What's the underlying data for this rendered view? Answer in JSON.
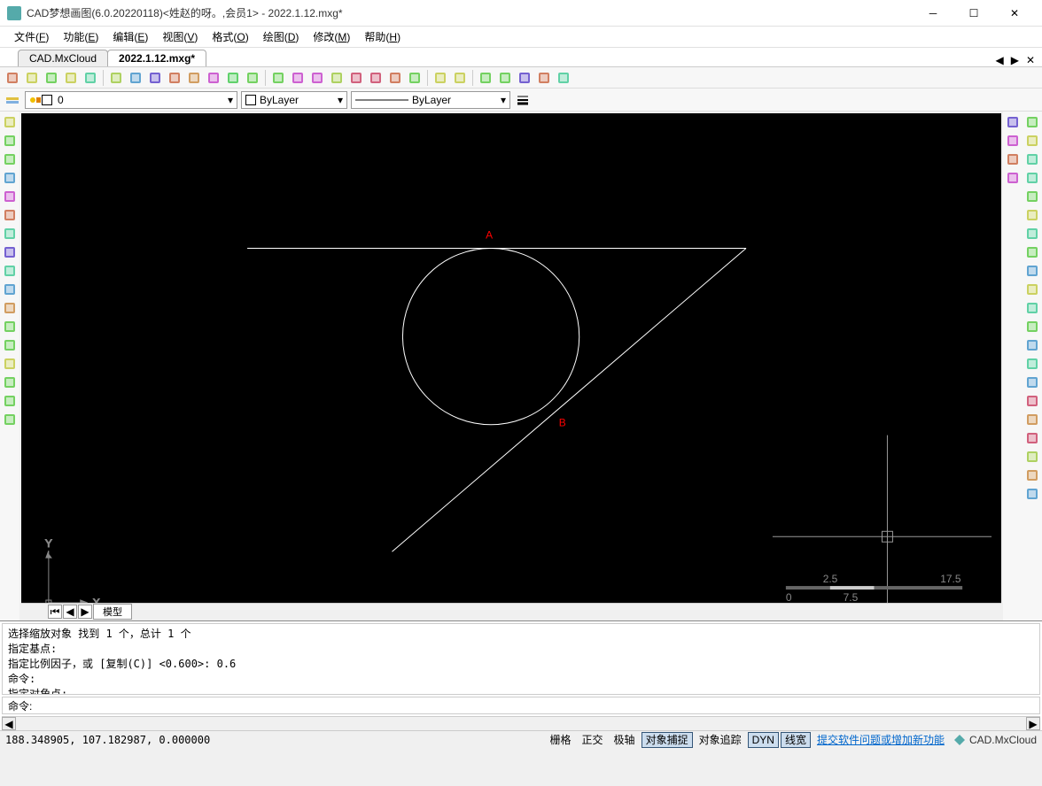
{
  "title": "CAD梦想画图(6.0.20220118)<姓赵的呀。,会员1> - 2022.1.12.mxg*",
  "menu": [
    "文件(F)",
    "功能(E)",
    "编辑(E)",
    "视图(V)",
    "格式(O)",
    "绘图(D)",
    "修改(M)",
    "帮助(H)"
  ],
  "tabs": {
    "items": [
      "CAD.MxCloud",
      "2022.1.12.mxg*"
    ],
    "active": 1
  },
  "layer": {
    "name": "0",
    "color_swatch": "#ffffff"
  },
  "colorSel": "ByLayer",
  "linetypeSel": "ByLayer",
  "canvas": {
    "labelA": "A",
    "labelB": "B",
    "axisX": "X",
    "axisY": "Y",
    "scale": {
      "l0": "0",
      "l1": "2.5",
      "l2": "7.5",
      "l3": "17.5"
    }
  },
  "modeltab": "模型",
  "cmdlog": "选择缩放对象  找到 1 个，总计 1 个\n指定基点:\n指定比例因子，或 [复制(C)] <0.600>: 0.6\n命令:\n指定对角点:\n命令:  *取消*",
  "cmdprompt": "命令:",
  "cmdinput": "",
  "status": {
    "coords": "188.348905, 107.182987, 0.000000",
    "buttons": [
      {
        "label": "栅格",
        "on": false
      },
      {
        "label": "正交",
        "on": false
      },
      {
        "label": "极轴",
        "on": false
      },
      {
        "label": "对象捕捉",
        "on": true
      },
      {
        "label": "对象追踪",
        "on": false
      },
      {
        "label": "DYN",
        "on": true
      },
      {
        "label": "线宽",
        "on": true
      }
    ],
    "link": "提交软件问题或增加新功能",
    "brand": "CAD.MxCloud"
  },
  "toolbar1_icons": [
    "new-icon",
    "open-icon",
    "open2-icon",
    "save-icon",
    "saveas-icon",
    "zoom-extents-icon",
    "zoom-in-icon",
    "zoom-out-icon",
    "pan-icon",
    "zoom-window-icon",
    "zoom-prev-icon",
    "zoom-realtime-icon",
    "regen-icon",
    "layer-icon",
    "layer-iso-icon",
    "layer-off-icon",
    "layer-freeze-icon",
    "layer-thaw-icon",
    "layer-lock-icon",
    "dim-icon",
    "print-icon",
    "undo-icon",
    "redo-icon",
    "cloud-icon",
    "globe-icon",
    "settings-icon",
    "pdf-icon",
    "export-icon"
  ],
  "left_icons": [
    "line-icon",
    "xline-icon",
    "pline-icon",
    "polygon-icon",
    "rectangle-icon",
    "arc-icon",
    "circle-icon",
    "revcloud-icon",
    "spline-icon",
    "ellipse-icon",
    "ellipse-arc-icon",
    "point-icon",
    "block-icon",
    "text-icon",
    "table-icon",
    "mtext-icon",
    "hatch-icon"
  ],
  "right_icons_a": [
    "copyclip-icon",
    "pasteclip-icon",
    "cut-icon",
    "matchprop-icon"
  ],
  "right_icons_b": [
    "erase-icon",
    "copy-icon",
    "mirror-icon",
    "offset-icon",
    "array-icon",
    "move-icon",
    "rotate-icon",
    "scale-icon",
    "stretch-icon",
    "trim-icon",
    "extend-icon",
    "break-icon",
    "chamfer-icon",
    "fillet-icon",
    "explode-icon",
    "dim-linear-icon",
    "dim-aligned-icon",
    "dim-radius-icon",
    "dim-diameter-icon",
    "dim-angular-icon",
    "dim-arc-icon"
  ]
}
